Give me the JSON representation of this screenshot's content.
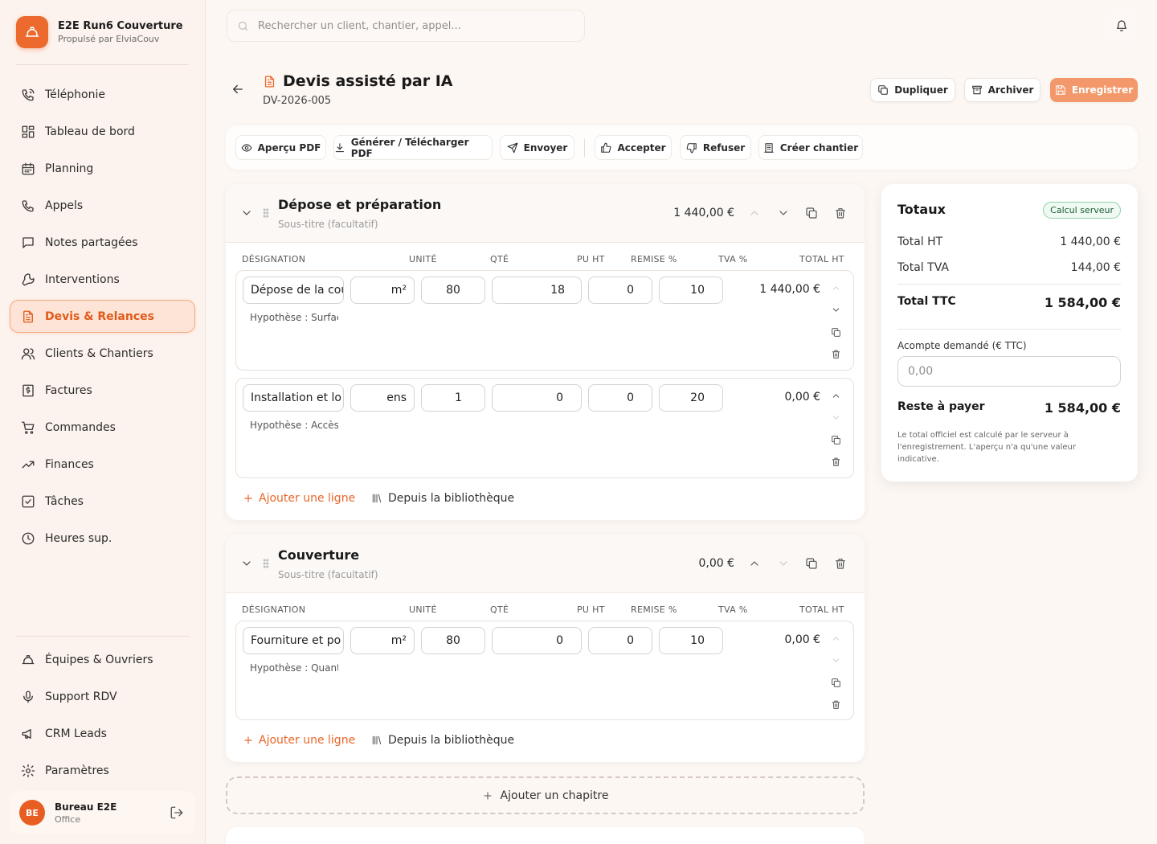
{
  "brand": {
    "title": "E2E Run6 Couverture",
    "subtitle": "Propulsé par ElviaCouv",
    "accent": "#ec6a2e"
  },
  "nav": {
    "main": [
      {
        "label": "Téléphonie",
        "icon": "phone-call-icon"
      },
      {
        "label": "Tableau de bord",
        "icon": "dashboard-icon"
      },
      {
        "label": "Planning",
        "icon": "calendar-icon"
      },
      {
        "label": "Appels",
        "icon": "phone-icon"
      },
      {
        "label": "Notes partagées",
        "icon": "message-icon"
      },
      {
        "label": "Interventions",
        "icon": "wrench-icon"
      },
      {
        "label": "Devis & Relances",
        "icon": "document-icon",
        "active": true
      },
      {
        "label": "Clients & Chantiers",
        "icon": "users-icon"
      },
      {
        "label": "Factures",
        "icon": "invoice-icon"
      },
      {
        "label": "Commandes",
        "icon": "cart-icon"
      },
      {
        "label": "Finances",
        "icon": "trending-up-icon"
      },
      {
        "label": "Tâches",
        "icon": "checkbox-icon"
      },
      {
        "label": "Heures sup.",
        "icon": "clock-icon"
      }
    ],
    "bottom": [
      {
        "label": "Équipes & Ouvriers",
        "icon": "hardhat-icon"
      },
      {
        "label": "Support RDV",
        "icon": "microphone-icon"
      },
      {
        "label": "CRM Leads",
        "icon": "megaphone-icon"
      },
      {
        "label": "Paramètres",
        "icon": "gear-icon"
      }
    ]
  },
  "user": {
    "initials": "BE",
    "name": "Bureau E2E",
    "role": "Office"
  },
  "search": {
    "placeholder": "Rechercher un client, chantier, appel..."
  },
  "header": {
    "title": "Devis assisté par IA",
    "reference": "DV-2026-005",
    "buttons": {
      "duplicate": "Dupliquer",
      "archive": "Archiver",
      "save": "Enregistrer"
    }
  },
  "toolbar": {
    "preview_pdf": "Aperçu PDF",
    "generate_pdf": "Générer / Télécharger PDF",
    "send": "Envoyer",
    "accept": "Accepter",
    "refuse": "Refuser",
    "create_site": "Créer chantier"
  },
  "columns": {
    "designation": "DÉSIGNATION",
    "unit": "UNITÉ",
    "qty": "QTÉ",
    "pu_ht": "PU HT",
    "discount": "REMISE %",
    "vat": "TVA %",
    "total_ht": "TOTAL HT"
  },
  "chapters": [
    {
      "title": "Dépose et préparation",
      "subtitle_placeholder": "Sous-titre (facultatif)",
      "total": "1 440,00 €",
      "lines": [
        {
          "designation": "Dépose de la cou",
          "unit": "m²",
          "qty": "80",
          "pu_ht": "18",
          "discount": "0",
          "vat": "10",
          "total": "1 440,00 €",
          "hypothesis": "Hypothèse : Surface"
        },
        {
          "designation": "Installation et lo",
          "unit": "ens",
          "qty": "1",
          "pu_ht": "0",
          "discount": "0",
          "vat": "20",
          "total": "0,00 €",
          "hypothesis": "Hypothèse : Accès s"
        }
      ]
    },
    {
      "title": "Couverture",
      "subtitle_placeholder": "Sous-titre (facultatif)",
      "total": "0,00 €",
      "lines": [
        {
          "designation": "Fourniture et po",
          "unit": "m²",
          "qty": "80",
          "pu_ht": "0",
          "discount": "0",
          "vat": "10",
          "total": "0,00 €",
          "hypothesis": "Hypothèse : Quanti"
        }
      ]
    }
  ],
  "actions": {
    "add_line": "Ajouter une ligne",
    "from_library": "Depuis la bibliothèque",
    "add_chapter": "Ajouter un chapitre"
  },
  "totals": {
    "title": "Totaux",
    "badge": "Calcul serveur",
    "total_ht_label": "Total HT",
    "total_ht": "1 440,00 €",
    "total_tva_label": "Total TVA",
    "total_tva": "144,00 €",
    "total_ttc_label": "Total TTC",
    "total_ttc": "1 584,00 €",
    "deposit_label": "Acompte demandé (€ TTC)",
    "deposit_placeholder": "0,00",
    "remaining_label": "Reste à payer",
    "remaining": "1 584,00 €",
    "note": "Le total officiel est calculé par le serveur à l'enregistrement. L'aperçu n'a qu'une valeur indicative."
  }
}
